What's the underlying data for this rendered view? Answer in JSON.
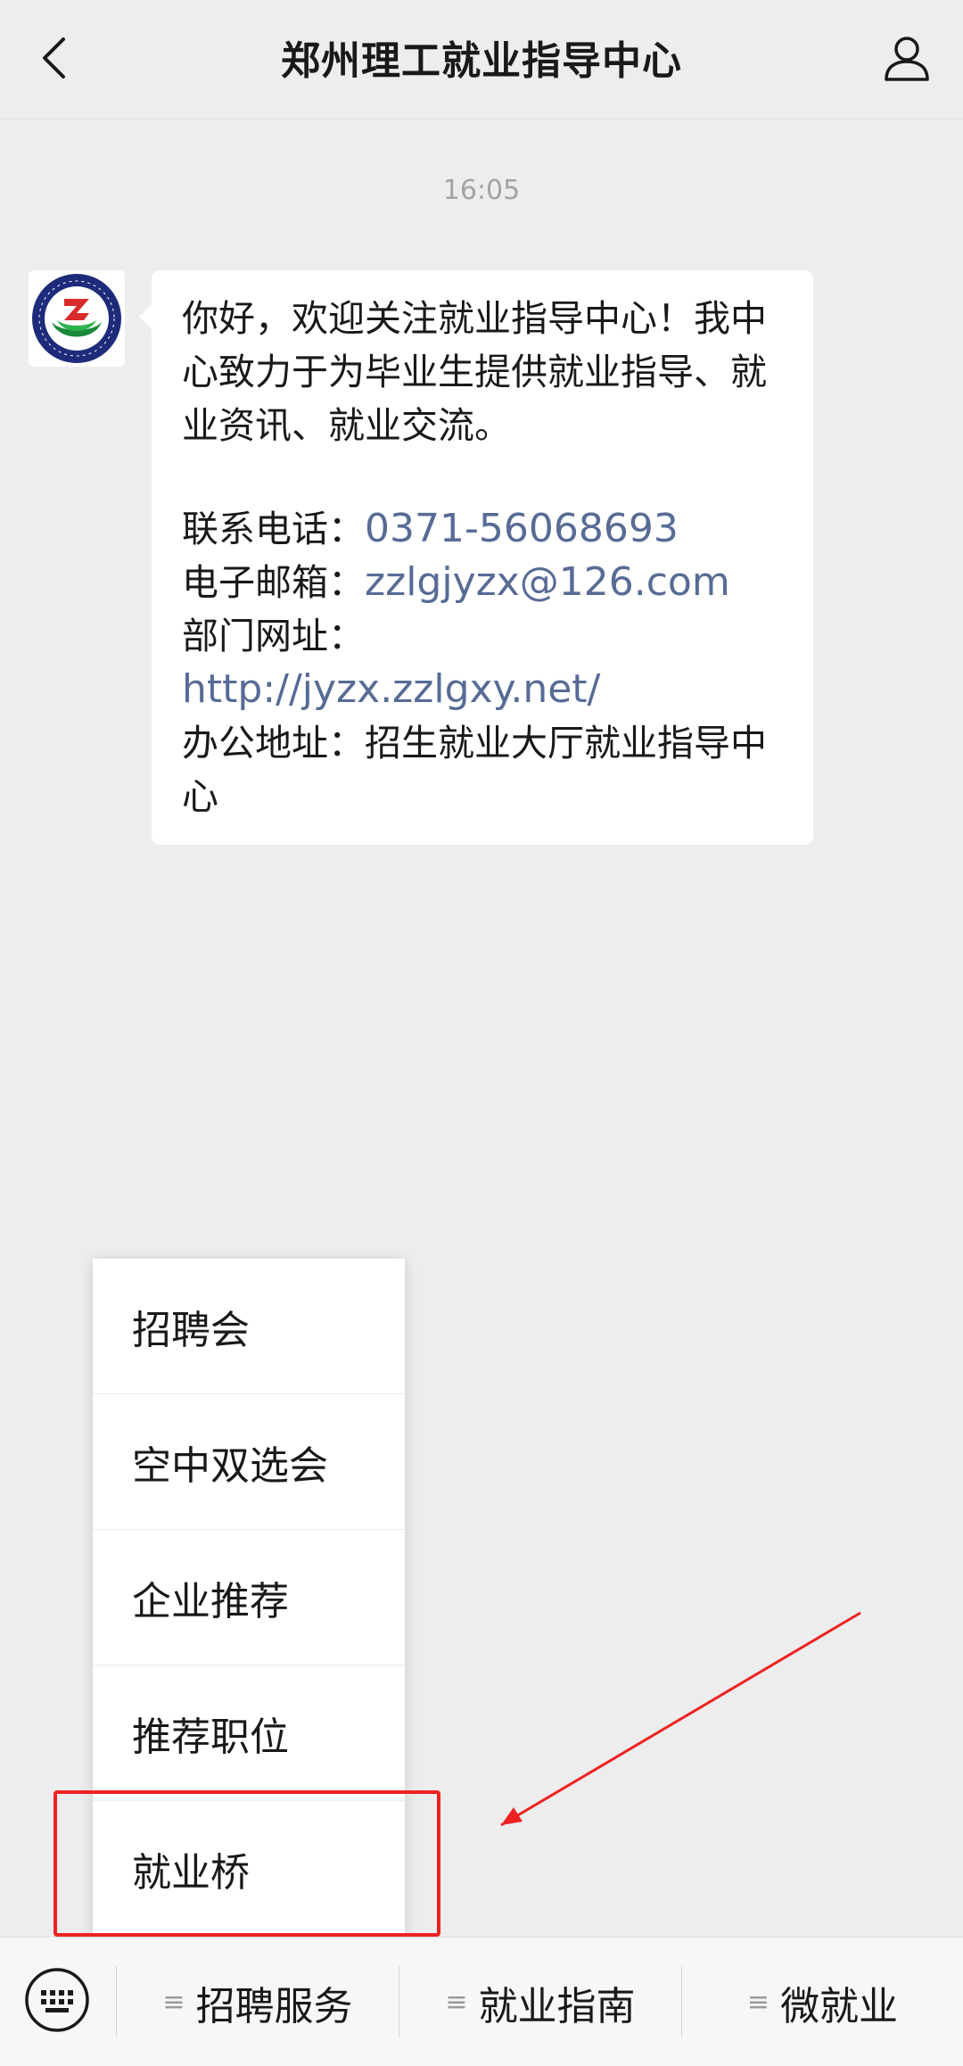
{
  "header": {
    "title": "郑州理工就业指导中心",
    "back_icon": "chevron-left-icon",
    "profile_icon": "person-icon"
  },
  "chat": {
    "timestamp": "16:05",
    "message": {
      "greeting": "你好，欢迎关注就业指导中心！我中心致力于为毕业生提供就业指导、就业资讯、就业交流。",
      "phone_label": "联系电话：",
      "phone_value": "0371-56068693",
      "email_label": "电子邮箱：",
      "email_value": "zzlgjyzx@126.com",
      "website_label": "部门网址：",
      "website_value": "http://jyzx.zzlgxy.net/",
      "address_label": "办公地址：",
      "address_value": "招生就业大厅就业指导中心"
    }
  },
  "popup_menu": {
    "items": [
      "招聘会",
      "空中双选会",
      "企业推荐",
      "推荐职位",
      "就业桥"
    ]
  },
  "bottom_bar": {
    "keyboard_icon": "keyboard-icon",
    "tab_icon": "≡",
    "tabs": [
      "招聘服务",
      "就业指南",
      "微就业"
    ]
  },
  "colors": {
    "background": "#ededed",
    "link": "#576b95",
    "annotation": "#ee2222"
  }
}
